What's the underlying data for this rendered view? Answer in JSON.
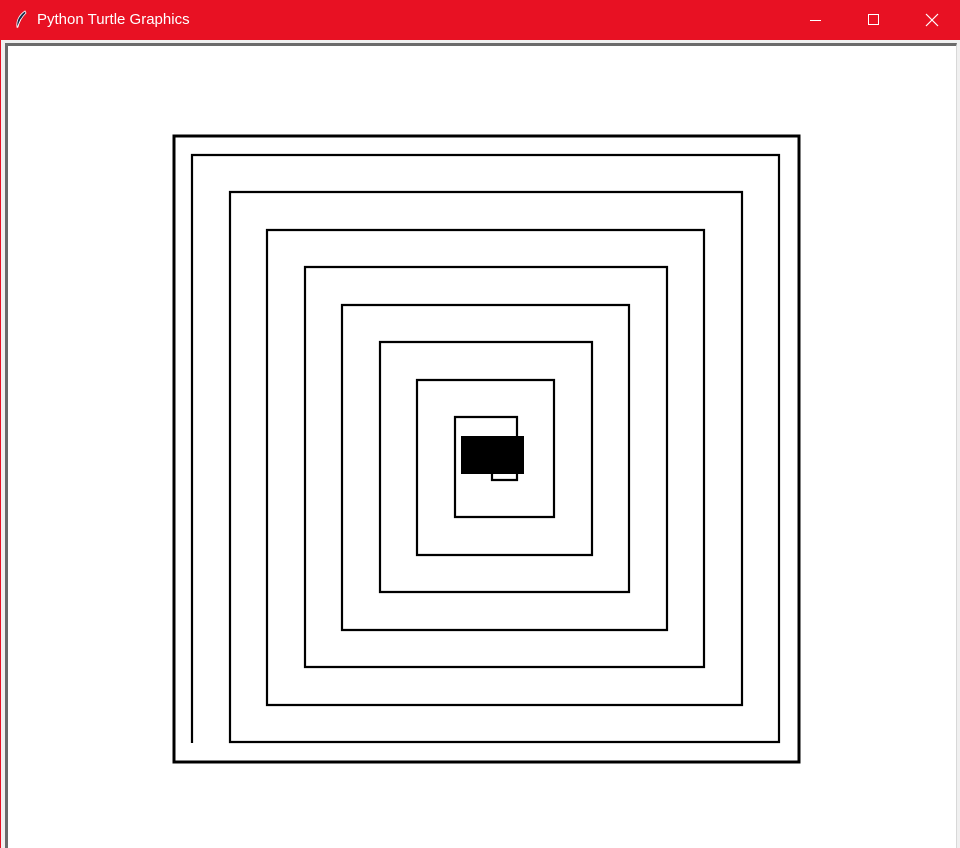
{
  "window": {
    "title": "Python Turtle Graphics",
    "app_icon": "feather-icon",
    "controls": {
      "minimize_icon": "minimize-icon",
      "maximize_icon": "maximize-icon",
      "close_icon": "close-icon"
    },
    "colors": {
      "titlebar": "#e81123",
      "title_text": "#ffffff",
      "canvas_background": "#ffffff",
      "pen": "#000000"
    }
  },
  "drawing": {
    "shape": "square-spiral",
    "turtle_cursor": "turtle-cursor-filled"
  }
}
